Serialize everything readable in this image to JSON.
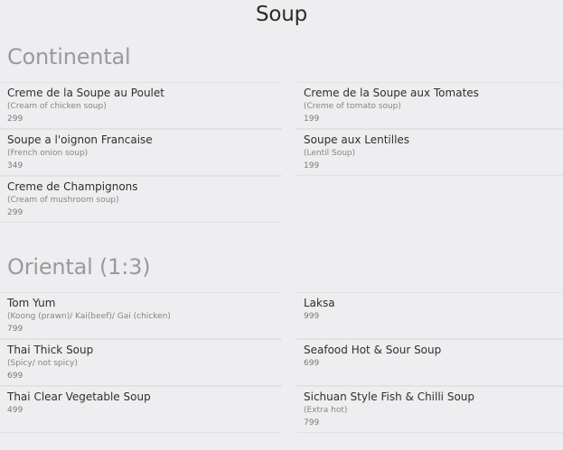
{
  "page": {
    "title": "Soup"
  },
  "sections": [
    {
      "title": "Continental",
      "items": [
        {
          "name": "Creme de la Soupe au Poulet",
          "desc": "(Cream of chicken soup)",
          "price": "299"
        },
        {
          "name": "Creme de la Soupe aux Tomates",
          "desc": "(Creme of tomato soup)",
          "price": "199"
        },
        {
          "name": "Soupe a l'oignon Francaise",
          "desc": "(French onion soup)",
          "price": "349"
        },
        {
          "name": "Soupe aux Lentilles",
          "desc": "(Lentil Soup)",
          "price": "199"
        },
        {
          "name": "Creme de Champignons",
          "desc": "(Cream of mushroom soup)",
          "price": "299"
        }
      ]
    },
    {
      "title": "Oriental (1:3)",
      "items": [
        {
          "name": "Tom Yum",
          "desc": "(Koong (prawn)/ Kai(beef)/ Gai (chicken)",
          "price": "799"
        },
        {
          "name": "Laksa",
          "desc": "",
          "price": "999"
        },
        {
          "name": "Thai Thick Soup",
          "desc": "(Spicy/ not spicy)",
          "price": "699"
        },
        {
          "name": "Seafood Hot & Sour Soup",
          "desc": "",
          "price": "699"
        },
        {
          "name": "Thai Clear Vegetable Soup",
          "desc": "",
          "price": "499"
        },
        {
          "name": "Sichuan Style Fish & Chilli Soup",
          "desc": "(Extra hot)",
          "price": "799"
        }
      ]
    }
  ]
}
